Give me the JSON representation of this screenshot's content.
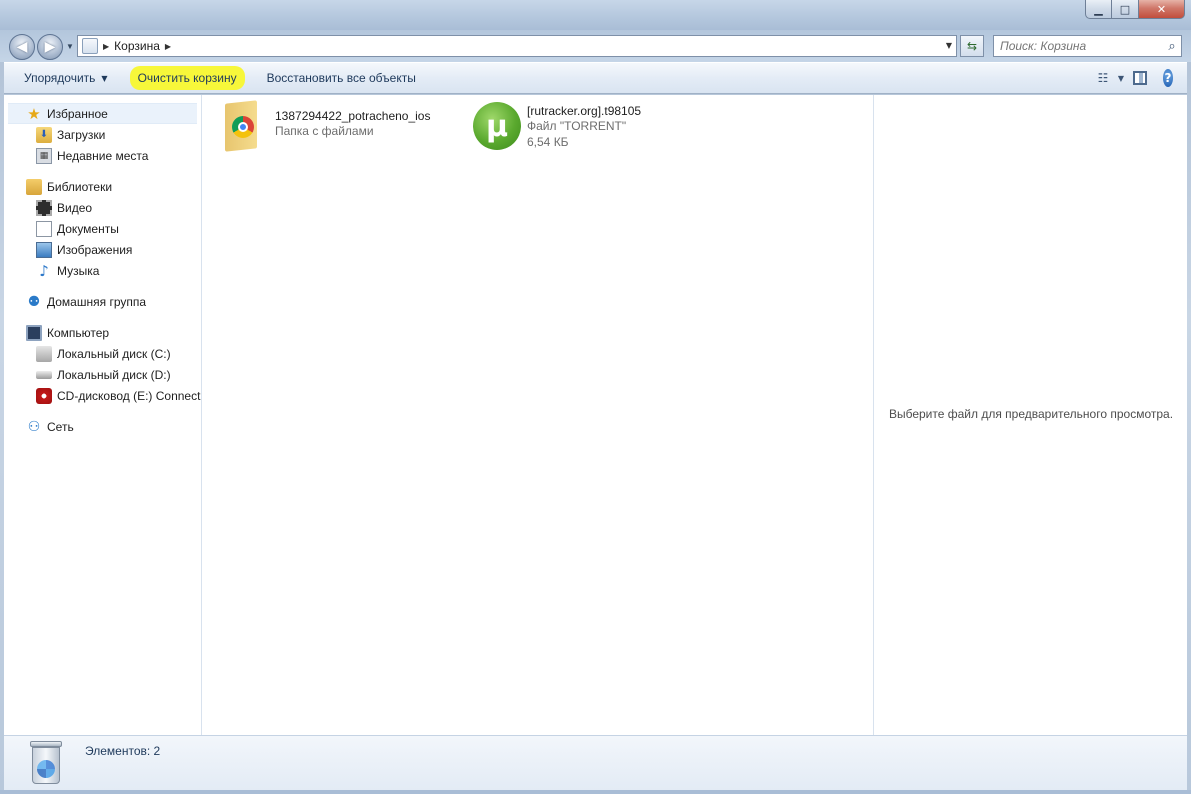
{
  "window": {
    "minimize_glyph": "▁",
    "maximize_glyph": "□",
    "close_glyph": "✕"
  },
  "nav": {
    "back_glyph": "◀",
    "forward_glyph": "▶",
    "address_path": "Корзина",
    "search_placeholder": "Поиск: Корзина"
  },
  "toolbar": {
    "organize_label": "Упорядочить",
    "empty_bin_label": "Очистить корзину",
    "restore_all_label": "Восстановить все объекты",
    "highlight_color": "#f7f73a"
  },
  "sidebar": {
    "groups": [
      {
        "label": "Избранное",
        "icon": "star-icon",
        "items": [
          {
            "label": "Загрузки",
            "icon": "downloads-folder-icon"
          },
          {
            "label": "Недавние места",
            "icon": "recent-places-icon"
          }
        ]
      },
      {
        "label": "Библиотеки",
        "icon": "libraries-icon",
        "items": [
          {
            "label": "Видео",
            "icon": "video-icon"
          },
          {
            "label": "Документы",
            "icon": "documents-icon"
          },
          {
            "label": "Изображения",
            "icon": "images-icon"
          },
          {
            "label": "Музыка",
            "icon": "music-icon"
          }
        ]
      },
      {
        "label": "Домашняя группа",
        "icon": "homegroup-icon",
        "items": []
      },
      {
        "label": "Компьютер",
        "icon": "computer-icon",
        "items": [
          {
            "label": "Локальный диск (C:)",
            "icon": "disk-c-icon"
          },
          {
            "label": "Локальный диск (D:)",
            "icon": "disk-d-icon"
          },
          {
            "label": "CD-дисковод (E:) Connect",
            "icon": "cd-drive-icon"
          }
        ]
      },
      {
        "label": "Сеть",
        "icon": "network-icon",
        "items": []
      }
    ]
  },
  "files": [
    {
      "name": "1387294422_potracheno_ios",
      "type": "Папка с файлами",
      "icon": "chrome-folder-icon"
    },
    {
      "name": "[rutracker.org].t98105",
      "type": "Файл \"TORRENT\"",
      "size": "6,54 КБ",
      "icon": "utorrent-icon"
    }
  ],
  "preview": {
    "message": "Выберите файл для предварительного просмотра."
  },
  "details": {
    "count_text": "Элементов: 2"
  }
}
